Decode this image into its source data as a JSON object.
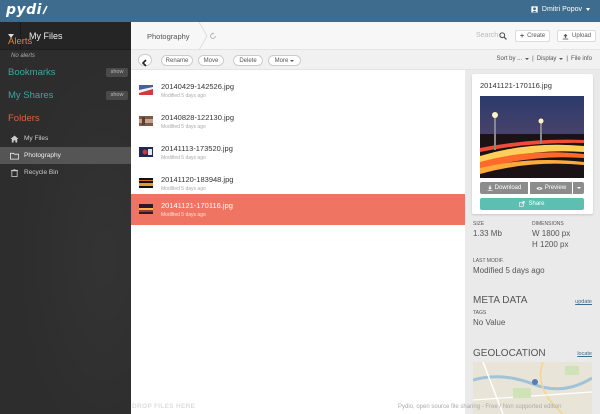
{
  "topbar": {
    "logo": "pydi",
    "user_name": "Dmitri Popov"
  },
  "sidebar": {
    "workspace": "My Files",
    "alerts_title": "Alerts",
    "no_alerts": "No alerts",
    "bookmarks_title": "Bookmarks",
    "shares_title": "My Shares",
    "show_label": "show",
    "folders_title": "Folders",
    "folders": [
      {
        "label": "My Files",
        "icon": "home-icon"
      },
      {
        "label": "Photography",
        "icon": "folder-icon",
        "active": true
      },
      {
        "label": "Recycle Bin",
        "icon": "recycle-icon"
      }
    ]
  },
  "breadcrumb": {
    "current": "Photography",
    "search_placeholder": "Search",
    "create_label": "Create",
    "upload_label": "Upload"
  },
  "toolbar": {
    "rename": "Rename",
    "move": "Move",
    "delete": "Delete",
    "more": "More",
    "sort_by": "Sort by ...",
    "sep": "|",
    "display": "Display",
    "file_info": "File info"
  },
  "files": [
    {
      "name": "20140429-142526.jpg",
      "modified": "Modified 5 days ago"
    },
    {
      "name": "20140828-122130.jpg",
      "modified": "Modified 5 days ago"
    },
    {
      "name": "20141113-173520.jpg",
      "modified": "Modified 5 days ago"
    },
    {
      "name": "20141120-183948.jpg",
      "modified": "Modified 5 days ago"
    },
    {
      "name": "20141121-170116.jpg",
      "modified": "Modified 5 days ago",
      "selected": true
    }
  ],
  "drop_hint": "DROP FILES HERE",
  "footer": "Pydio, open source file sharing - Free / Non supported edition",
  "info": {
    "file_name": "20141121-170116.jpg",
    "download": "Download",
    "preview": "Preview",
    "share": "Share",
    "size_label": "SIZE",
    "size_value": "1.33 Mb",
    "dim_label": "DIMENSIONS",
    "width": "W 1800 px",
    "height": "H 1200 px",
    "lastmod_label": "LAST MODIF.",
    "lastmod_value": "Modified 5 days ago",
    "meta_title": "META DATA",
    "update_link": "update",
    "tags_label": "TAGS",
    "tags_value": "No Value",
    "geo_title": "GEOLOCATION",
    "locate_link": "locate"
  },
  "colors": {
    "topbar": "#3d6c8e",
    "sidebar": "#2d2d2d",
    "selected_row": "#ef7461",
    "share_button": "#5cbfb2",
    "alerts": "#e2823a",
    "bookmarks": "#3fa5a0",
    "folders": "#d9643f"
  }
}
